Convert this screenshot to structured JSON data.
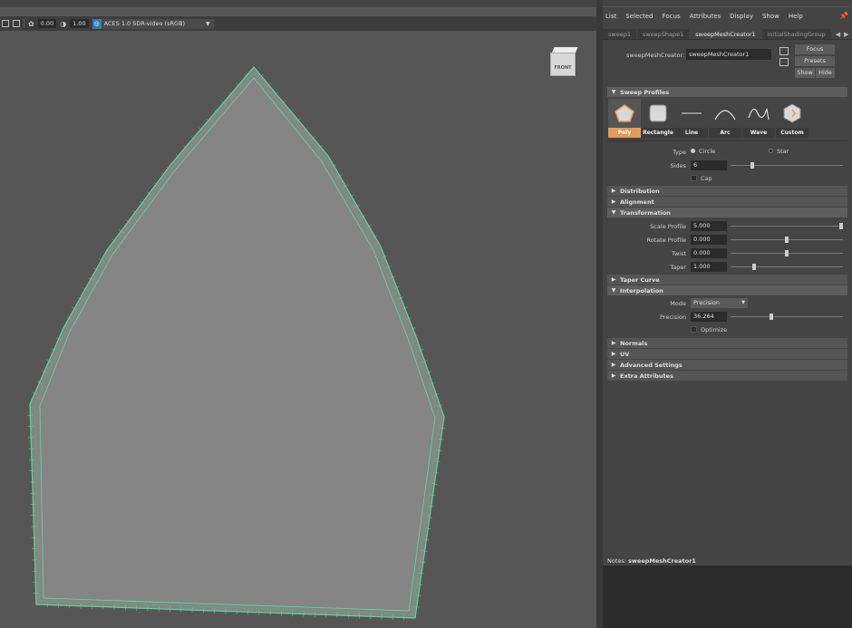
{
  "viewport": {
    "toolbar": {
      "exposure": "0.00",
      "gamma": "1.00",
      "color_space": "ACES 1.0 SDR-video (sRGB)"
    },
    "viewcube_label": "FRONT"
  },
  "ae": {
    "menu": [
      "List",
      "Selected",
      "Focus",
      "Attributes",
      "Display",
      "Show",
      "Help"
    ],
    "tabs": [
      "sweep1",
      "sweepShape1",
      "sweepMeshCreator1",
      "initialShadingGroup"
    ],
    "active_tab": 2,
    "node_label": "sweepMeshCreator:",
    "node_name": "sweepMeshCreator1",
    "buttons": {
      "focus": "Focus",
      "presets": "Presets",
      "show": "Show",
      "hide": "Hide"
    },
    "sections": {
      "sweep_profiles": "Sweep Profiles",
      "distribution": "Distribution",
      "alignment": "Alignment",
      "transformation": "Transformation",
      "taper_curve": "Taper Curve",
      "interpolation": "Interpolation",
      "normals": "Normals",
      "uv": "UV",
      "advanced": "Advanced Settings",
      "extra": "Extra Attributes"
    },
    "profiles": [
      "Poly",
      "Rectangle",
      "Line",
      "Arc",
      "Wave",
      "Custom"
    ],
    "active_profile": 0,
    "type": {
      "label": "Type",
      "opt1": "Circle",
      "opt2": "Star",
      "selected": "Circle"
    },
    "sides": {
      "label": "Sides",
      "value": "6",
      "fraction": 0.18
    },
    "cap": {
      "label": "Cap",
      "checked": false
    },
    "scale_profile": {
      "label": "Scale Profile",
      "value": "5.000",
      "fraction": 1.0
    },
    "rotate_profile": {
      "label": "Rotate Profile",
      "value": "0.000",
      "fraction": 0.5
    },
    "twist": {
      "label": "Twist",
      "value": "0.000",
      "fraction": 0.5
    },
    "taper": {
      "label": "Taper",
      "value": "1.000",
      "fraction": 0.2
    },
    "mode": {
      "label": "Mode",
      "value": "Precision"
    },
    "precision": {
      "label": "Precision",
      "value": "36.264",
      "fraction": 0.36
    },
    "optimize": {
      "label": "Optimize",
      "checked": false
    },
    "notes": {
      "label": "Notes:",
      "node": "sweepMeshCreator1"
    }
  },
  "colors": {
    "accent": "#e49a5a",
    "mesh_wire": "#5fd3a0",
    "mesh_fill": "#858585"
  }
}
